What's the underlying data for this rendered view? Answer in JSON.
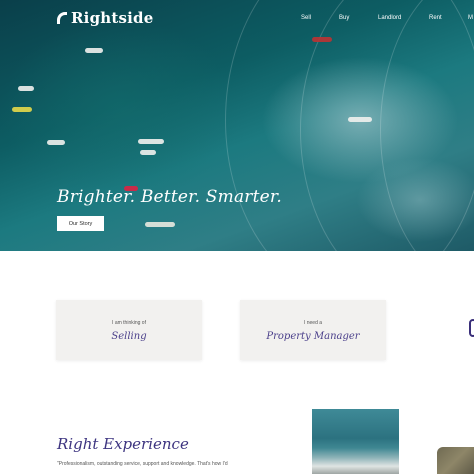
{
  "header": {
    "logo_text": "Rightside",
    "nav": [
      "Sell",
      "Buy",
      "Landlord",
      "Rent",
      "M"
    ]
  },
  "hero": {
    "tagline": "Brighter. Better. Smarter.",
    "cta_label": "Our Story"
  },
  "cards": [
    {
      "pre": "I am thinking of",
      "main": "Selling"
    },
    {
      "pre": "I need a",
      "main": "Property Manager"
    }
  ],
  "experience": {
    "title": "Right Experience",
    "body": "\"Professionalism, outstanding service, support and knowledge. That's how I'd"
  },
  "colors": {
    "accent": "#3d3480",
    "card_bg": "#f2f1ef"
  }
}
